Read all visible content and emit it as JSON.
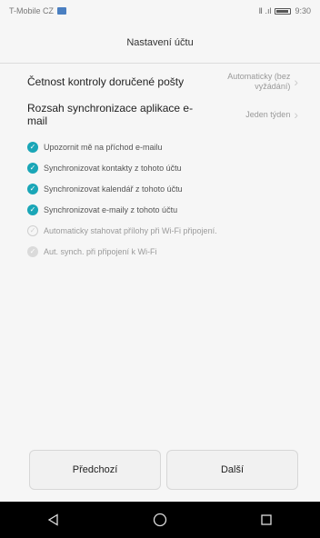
{
  "status_bar": {
    "carrier": "T-Mobile CZ",
    "signal_text": "Ⅱ .ıl",
    "time": "9:30"
  },
  "header": {
    "title": "Nastavení účtu"
  },
  "settings": [
    {
      "label": "Četnost kontroly doručené pošty",
      "value": "Automaticky (bez vyžádání)"
    },
    {
      "label": "Rozsah synchronizace aplikace e-mail",
      "value": "Jeden týden"
    }
  ],
  "checkboxes": [
    {
      "label": "Upozornit mě na příchod e-mailu",
      "state": "checked"
    },
    {
      "label": "Synchronizovat kontakty z tohoto účtu",
      "state": "checked"
    },
    {
      "label": "Synchronizovat kalendář z tohoto účtu",
      "state": "checked"
    },
    {
      "label": "Synchronizovat e-maily z tohoto účtu",
      "state": "checked"
    },
    {
      "label": "Automaticky stahovat přílohy při Wi-Fi připojení.",
      "state": "unchecked"
    },
    {
      "label": "Aut. synch. při připojení k Wi-Fi",
      "state": "disabled"
    }
  ],
  "buttons": {
    "previous": "Předchozí",
    "next": "Další"
  },
  "colors": {
    "accent": "#1aa6b7",
    "background": "#f6f6f6",
    "nav_bar": "#000000"
  },
  "icons": {
    "back": "back-triangle-icon",
    "home": "home-circle-icon",
    "recents": "recents-square-icon"
  }
}
